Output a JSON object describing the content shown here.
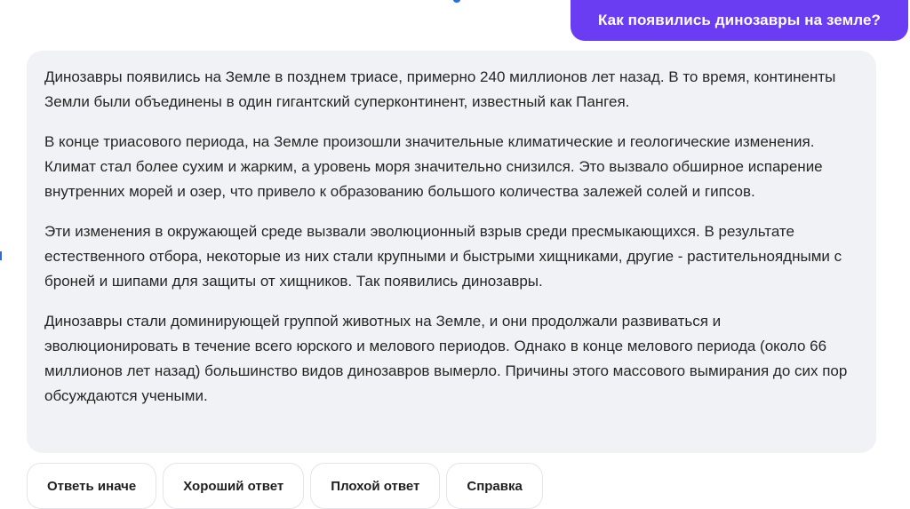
{
  "user_message": "Как появились динозавры на земле?",
  "answer": {
    "paragraphs": [
      "Динозавры появились на Земле в позднем триасе, примерно 240 миллионов лет назад. В то время, континенты Земли были объединены в один гигантский суперконтинент, известный как Пангея.",
      "В конце триасового периода, на Земле произошли значительные климатические и геологические изменения. Климат стал более сухим и жарким, а уровень моря значительно снизился. Это вызвало обширное испарение внутренних морей и озер, что привело к образованию большого количества залежей солей и гипсов.",
      "Эти изменения в окружающей среде вызвали эволюционный взрыв среди пресмыкающихся. В результате естественного отбора, некоторые из них стали крупными и быстрыми хищниками, другие - растительноядными с броней и шипами для защиты от хищников. Так появились динозавры.",
      "Динозавры стали доминирующей группой животных на Земле, и они продолжали развиваться и эволюционировать в течение всего юрского и мелового периодов. Однако в конце мелового периода (около 66 миллионов лет назад) большинство видов динозавров вымерло. Причины этого массового вымирания до сих пор обсуждаются учеными."
    ]
  },
  "actions": {
    "regenerate": "Ответь иначе",
    "good": "Хороший ответ",
    "bad": "Плохой ответ",
    "help": "Справка"
  },
  "colors": {
    "user_bubble": "#6a3cf2",
    "answer_bg": "#f1f2f5"
  }
}
